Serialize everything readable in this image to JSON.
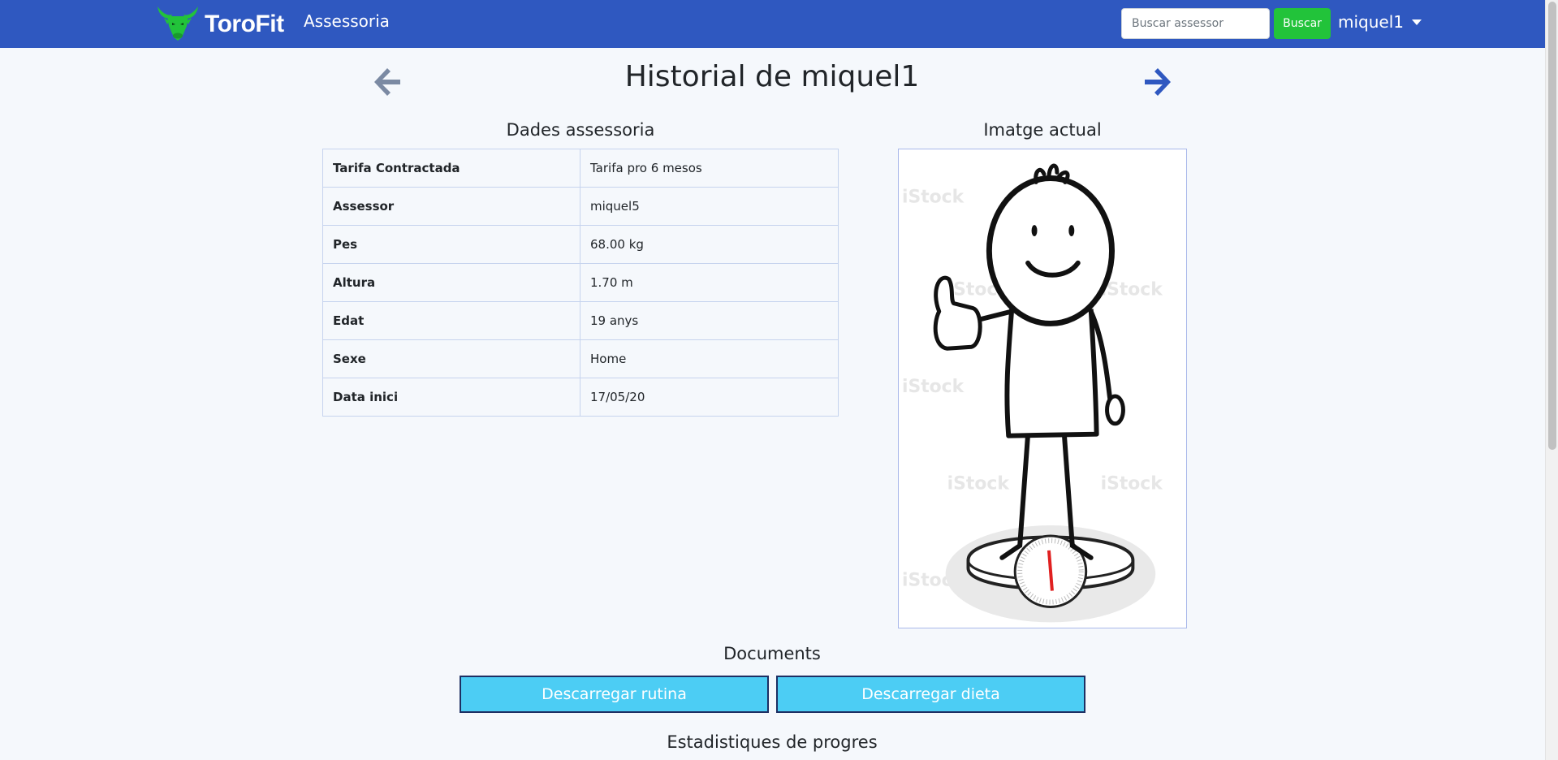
{
  "navbar": {
    "brand": "ToroFit",
    "nav_link": "Assessoria",
    "search_placeholder": "Buscar assessor",
    "search_button": "Buscar",
    "user": "miquel1",
    "bg_color": "#2f58c0",
    "brand_icon": "bull-logo-icon"
  },
  "page": {
    "title": "Historial de miquel1",
    "prev_icon": "arrow-left-icon",
    "next_icon": "arrow-right-icon"
  },
  "dades": {
    "title": "Dades assessoria",
    "rows": [
      {
        "label": "Tarifa Contractada",
        "value": "Tarifa pro 6 mesos"
      },
      {
        "label": "Assessor",
        "value": "miquel5"
      },
      {
        "label": "Pes",
        "value": "68.00 kg"
      },
      {
        "label": "Altura",
        "value": "1.70 m"
      },
      {
        "label": "Edat",
        "value": "19 anys"
      },
      {
        "label": "Sexe",
        "value": "Home"
      },
      {
        "label": "Data inici",
        "value": "17/05/20"
      }
    ]
  },
  "imatge": {
    "title": "Imatge actual",
    "watermark": "iStock"
  },
  "documents": {
    "title": "Documents",
    "rutina_button": "Descarregar rutina",
    "dieta_button": "Descarregar dieta",
    "button_color": "#4ccdf4"
  },
  "estadistiques": {
    "title": "Estadistiques de progres"
  }
}
